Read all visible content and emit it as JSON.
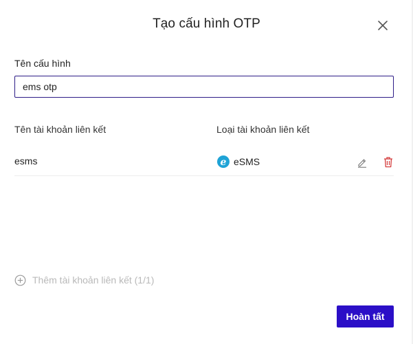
{
  "dialog": {
    "title": "Tạo cấu hình OTP",
    "close_icon": "close-icon"
  },
  "form": {
    "name_label": "Tên cấu hình",
    "name_value": "ems otp"
  },
  "table": {
    "columns": [
      "Tên tài khoản liên kết",
      "Loại tài khoản liên kết"
    ],
    "rows": [
      {
        "account": "esms",
        "type_label": "eSMS",
        "type_logo_letter": "e",
        "type_logo_color": "#1fa3d6",
        "edit_icon": "edit-icon",
        "delete_icon": "trash-icon"
      }
    ]
  },
  "add_account": {
    "label": "Thêm tài khoản liên kết (1/1)",
    "icon": "plus-circle-icon",
    "enabled": false
  },
  "footer": {
    "finish_label": "Hoàn tất"
  },
  "colors": {
    "primary": "#2b0fc7",
    "input_border": "#2b1a86",
    "danger": "#d43c3c",
    "disabled_text": "#b9b9b9"
  }
}
